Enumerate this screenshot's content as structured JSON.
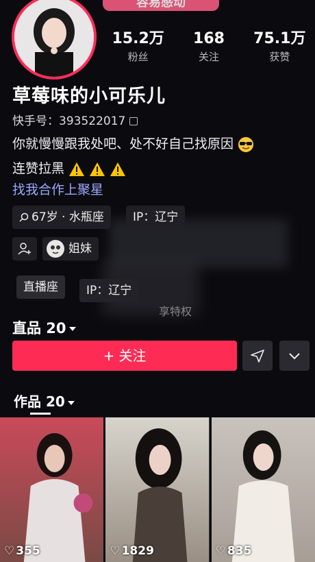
{
  "banner": "容易感动",
  "stats": [
    {
      "value": "15.2万",
      "label": "粉丝"
    },
    {
      "value": "168",
      "label": "关注"
    },
    {
      "value": "75.1万",
      "label": "获赞"
    }
  ],
  "profile": {
    "name": "草莓味的小可乐儿",
    "kuaishou_id": "快手号：393522017",
    "bio_line1": "你就慢慢跟我处吧、处不好自己找原因",
    "bio_line2": "连赞拉黑",
    "link": "找我合作上聚星"
  },
  "tags": {
    "age": "67岁 · 水瓶座",
    "ip": "IP：辽宁",
    "sister": "姐妹",
    "live": "直播座",
    "ip2": "IP：辽宁",
    "ghost": "享特权"
  },
  "actions": {
    "follow_label": "+ 关注",
    "works_ghost": "直品 20"
  },
  "works": {
    "title": "作品 20",
    "items": [
      {
        "likes": "355"
      },
      {
        "likes": "1829"
      },
      {
        "likes": "835"
      }
    ]
  },
  "colors": {
    "accent": "#fe2c55",
    "link": "#9aa8ff",
    "background": "#0b0b0f"
  }
}
